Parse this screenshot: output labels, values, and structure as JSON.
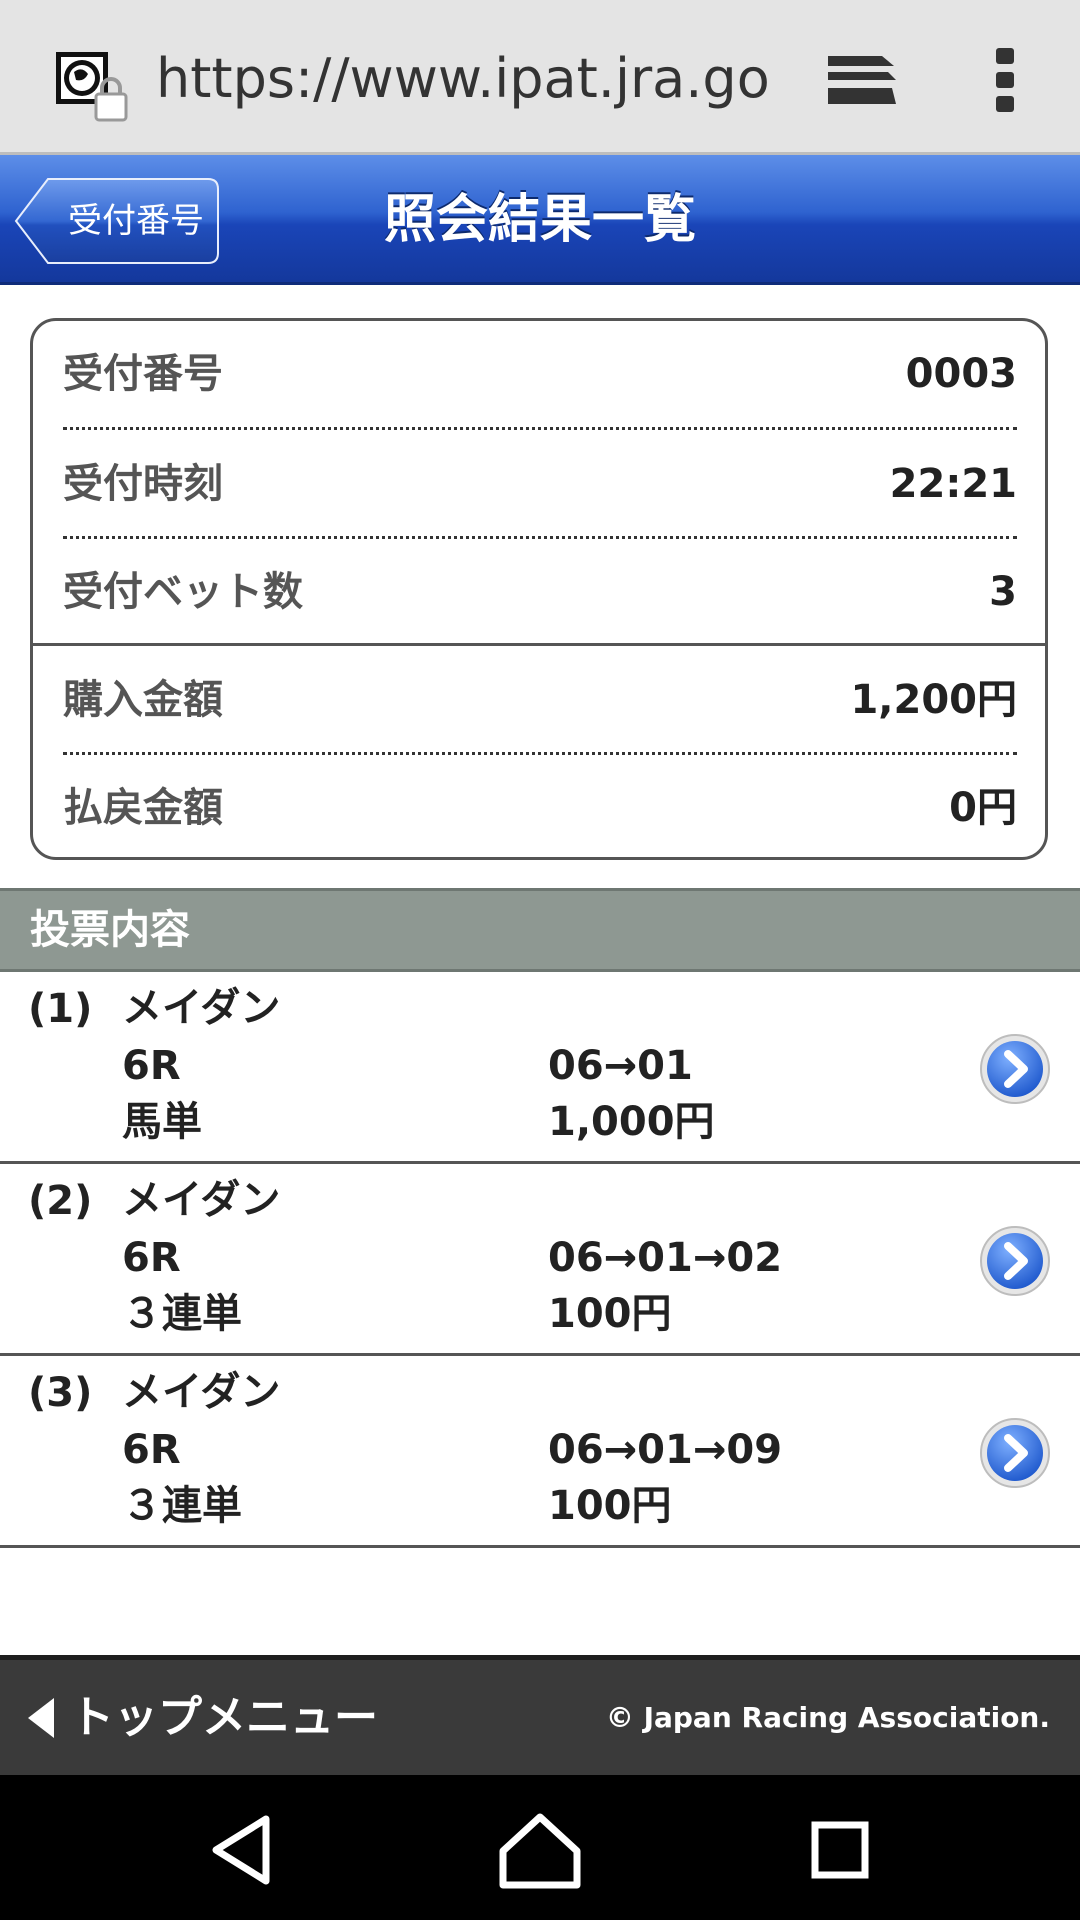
{
  "browser": {
    "url": "https://www.ipat.jra.go.jp/",
    "site_icon": "secure-site-lock-icon",
    "tabs_icon": "tabs-icon",
    "menu_icon": "more-vert-icon"
  },
  "header": {
    "back_label": "受付番号",
    "title": "照会結果一覧",
    "colors": {
      "gradient_top": "#5d8ee8",
      "gradient_bottom": "#14389c"
    }
  },
  "summary": {
    "rows": [
      {
        "label": "受付番号",
        "value": "0003"
      },
      {
        "label": "受付時刻",
        "value": "22:21"
      },
      {
        "label": "受付ベット数",
        "value": "3"
      },
      {
        "label": "購入金額",
        "value": "1,200円"
      },
      {
        "label": "払戻金額",
        "value": "0円"
      }
    ]
  },
  "section": {
    "title": "投票内容",
    "color": "#8e9892"
  },
  "bets": [
    {
      "num": "(1)",
      "race_name": "メイダン",
      "race": "6R",
      "type": "馬単",
      "combo": "06→01",
      "amount": "1,000円"
    },
    {
      "num": "(2)",
      "race_name": "メイダン",
      "race": "6R",
      "type": "３連単",
      "combo": "06→01→02",
      "amount": "100円"
    },
    {
      "num": "(3)",
      "race_name": "メイダン",
      "race": "6R",
      "type": "３連単",
      "combo": "06→01→09",
      "amount": "100円"
    }
  ],
  "footer": {
    "top_menu_label": "トップメニュー",
    "copyright": "© Japan Racing Association."
  },
  "android_nav": [
    "back-icon",
    "home-icon",
    "recents-icon"
  ]
}
